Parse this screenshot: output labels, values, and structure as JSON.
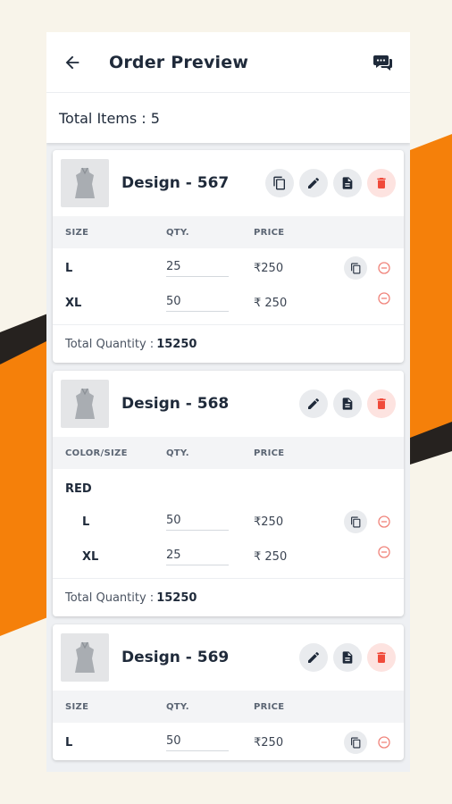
{
  "header": {
    "title": "Order Preview",
    "back_icon": "arrow-back-icon",
    "chat_icon": "chat-icon"
  },
  "summary": {
    "total_items_label": "Total Items : 5"
  },
  "colors": {
    "accent_orange": "#f5800a",
    "dark_stripe": "#26221f",
    "delete_red": "#f04a3a"
  },
  "designs": [
    {
      "name": "Design - 567",
      "headers": [
        "SIZE",
        "QTY.",
        "PRICE"
      ],
      "rows": [
        {
          "size": "L",
          "qty": "25",
          "price": "₹250"
        },
        {
          "size": "XL",
          "qty": "50",
          "price": "₹ 250"
        }
      ],
      "total_label": "Total Quantity :",
      "total_value": "15250"
    },
    {
      "name": "Design - 568",
      "headers": [
        "COLOR/SIZE",
        "QTY.",
        "PRICE"
      ],
      "color": "RED",
      "rows": [
        {
          "size": "L",
          "qty": "50",
          "price": "₹250"
        },
        {
          "size": "XL",
          "qty": "25",
          "price": "₹ 250"
        }
      ],
      "total_label": "Total Quantity :",
      "total_value": "15250"
    },
    {
      "name": "Design - 569",
      "headers": [
        "SIZE",
        "QTY.",
        "PRICE"
      ],
      "rows": [
        {
          "size": "L",
          "qty": "50",
          "price": "₹250"
        }
      ]
    }
  ]
}
